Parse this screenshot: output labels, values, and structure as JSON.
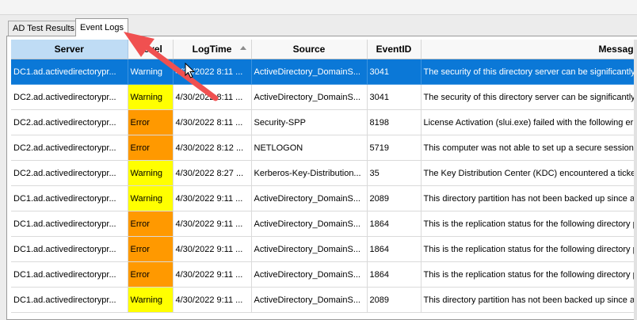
{
  "tabs": [
    {
      "label": "AD Test Results",
      "active": false
    },
    {
      "label": "Event Logs",
      "active": true
    }
  ],
  "columns": {
    "server": "Server",
    "level": "Level",
    "logtime": "LogTime",
    "source": "Source",
    "eventid": "EventID",
    "message": "Message"
  },
  "rows": [
    {
      "server": "DC1.ad.activedirectorypr...",
      "level": "Warning",
      "logtime": "4/30/2022 8:11 ...",
      "source": "ActiveDirectory_DomainS...",
      "eventid": "3041",
      "message": "The security of this directory server can be significantly",
      "selected": true
    },
    {
      "server": "DC2.ad.activedirectorypr...",
      "level": "Warning",
      "logtime": "4/30/2022 8:11 ...",
      "source": "ActiveDirectory_DomainS...",
      "eventid": "3041",
      "message": "The security of this directory server can be significantly",
      "selected": false
    },
    {
      "server": "DC2.ad.activedirectorypr...",
      "level": "Error",
      "logtime": "4/30/2022 8:11 ...",
      "source": "Security-SPP",
      "eventid": "8198",
      "message": "License Activation (slui.exe) failed with the following err",
      "selected": false
    },
    {
      "server": "DC2.ad.activedirectorypr...",
      "level": "Error",
      "logtime": "4/30/2022 8:12 ...",
      "source": "NETLOGON",
      "eventid": "5719",
      "message": "This computer was not able to set up a secure session w",
      "selected": false
    },
    {
      "server": "DC2.ad.activedirectorypr...",
      "level": "Warning",
      "logtime": "4/30/2022 8:27 ...",
      "source": "Kerberos-Key-Distribution...",
      "eventid": "35",
      "message": "The Key Distribution Center (KDC) encountered a ticket-",
      "selected": false
    },
    {
      "server": "DC1.ad.activedirectorypr...",
      "level": "Warning",
      "logtime": "4/30/2022 9:11 ...",
      "source": "ActiveDirectory_DomainS...",
      "eventid": "2089",
      "message": "This directory partition has not been backed up since at",
      "selected": false
    },
    {
      "server": "DC1.ad.activedirectorypr...",
      "level": "Error",
      "logtime": "4/30/2022 9:11 ...",
      "source": "ActiveDirectory_DomainS...",
      "eventid": "1864",
      "message": "This is the replication status for the following directory p",
      "selected": false
    },
    {
      "server": "DC1.ad.activedirectorypr...",
      "level": "Error",
      "logtime": "4/30/2022 9:11 ...",
      "source": "ActiveDirectory_DomainS...",
      "eventid": "1864",
      "message": "This is the replication status for the following directory p",
      "selected": false
    },
    {
      "server": "DC1.ad.activedirectorypr...",
      "level": "Error",
      "logtime": "4/30/2022 9:11 ...",
      "source": "ActiveDirectory_DomainS...",
      "eventid": "1864",
      "message": "This is the replication status for the following directory p",
      "selected": false
    },
    {
      "server": "DC1.ad.activedirectorypr...",
      "level": "Warning",
      "logtime": "4/30/2022 9:11 ...",
      "source": "ActiveDirectory_DomainS...",
      "eventid": "2089",
      "message": "This directory partition has not been backed up since at",
      "selected": false
    }
  ],
  "colors": {
    "selected_row": "#0b78d7",
    "warning": "#ffff00",
    "error": "#ff9900",
    "sorted_header": "#bfdcf5",
    "annotation_arrow": "#f05050"
  },
  "icons": {
    "sort": "sort-ascending-icon",
    "cursor": "mouse-pointer-icon",
    "annotation": "red-arrow-icon"
  }
}
